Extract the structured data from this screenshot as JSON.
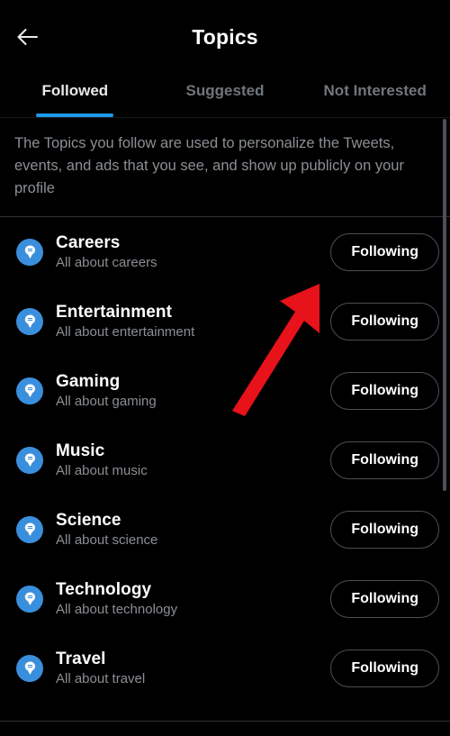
{
  "header": {
    "title": "Topics",
    "back_icon": "arrow-left-icon"
  },
  "tabs": [
    {
      "label": "Followed",
      "active": true
    },
    {
      "label": "Suggested",
      "active": false
    },
    {
      "label": "Not Interested",
      "active": false
    }
  ],
  "description": "The Topics you follow are used to personalize the Tweets, events, and ads that you see, and show up publicly on your profile",
  "topics": [
    {
      "title": "Careers",
      "subtitle": "All about careers",
      "button": "Following",
      "icon": "topic-bubble-icon"
    },
    {
      "title": "Entertainment",
      "subtitle": "All about entertainment",
      "button": "Following",
      "icon": "topic-bubble-icon"
    },
    {
      "title": "Gaming",
      "subtitle": "All about gaming",
      "button": "Following",
      "icon": "topic-bubble-icon"
    },
    {
      "title": "Music",
      "subtitle": "All about music",
      "button": "Following",
      "icon": "topic-bubble-icon"
    },
    {
      "title": "Science",
      "subtitle": "All about science",
      "button": "Following",
      "icon": "topic-bubble-icon"
    },
    {
      "title": "Technology",
      "subtitle": "All about technology",
      "button": "Following",
      "icon": "topic-bubble-icon"
    },
    {
      "title": "Travel",
      "subtitle": "All about travel",
      "button": "Following",
      "icon": "topic-bubble-icon"
    }
  ],
  "annotation": {
    "type": "arrow",
    "color": "#e8121b",
    "points_to": "Following button on Careers row"
  },
  "colors": {
    "background": "#000000",
    "accent": "#1d9bf0",
    "topic_icon": "#3a8fdd",
    "muted_text": "#8b8f94",
    "divider": "#2f3336"
  }
}
